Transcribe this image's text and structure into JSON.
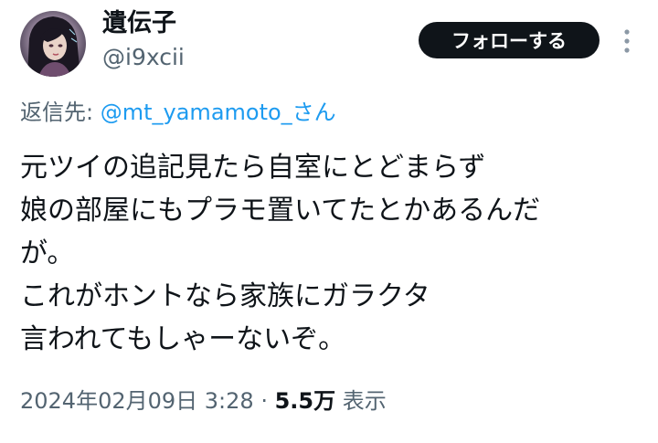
{
  "user": {
    "display_name": "遺伝子",
    "handle": "@i9xcii"
  },
  "actions": {
    "follow_label": "フォローする",
    "more_icon": "more-vertical-icon"
  },
  "reply": {
    "prefix": "返信先:",
    "mention": "@mt_yamamoto_さん"
  },
  "tweet": {
    "lines": [
      "元ツイの追記見たら自室にとどまらず",
      "娘の部屋にもプラモ置いてたとかあるんだ",
      "が。",
      "これがホントなら家族にガラクタ",
      "言われてもしゃーないぞ。"
    ]
  },
  "meta": {
    "timestamp": "2024年02月09日 3:28",
    "separator": "·",
    "views_count": "5.5万",
    "views_label": "表示"
  },
  "colors": {
    "text": "#0f1419",
    "secondary": "#536471",
    "link": "#1d9bf0",
    "button_bg": "#0f1419"
  }
}
